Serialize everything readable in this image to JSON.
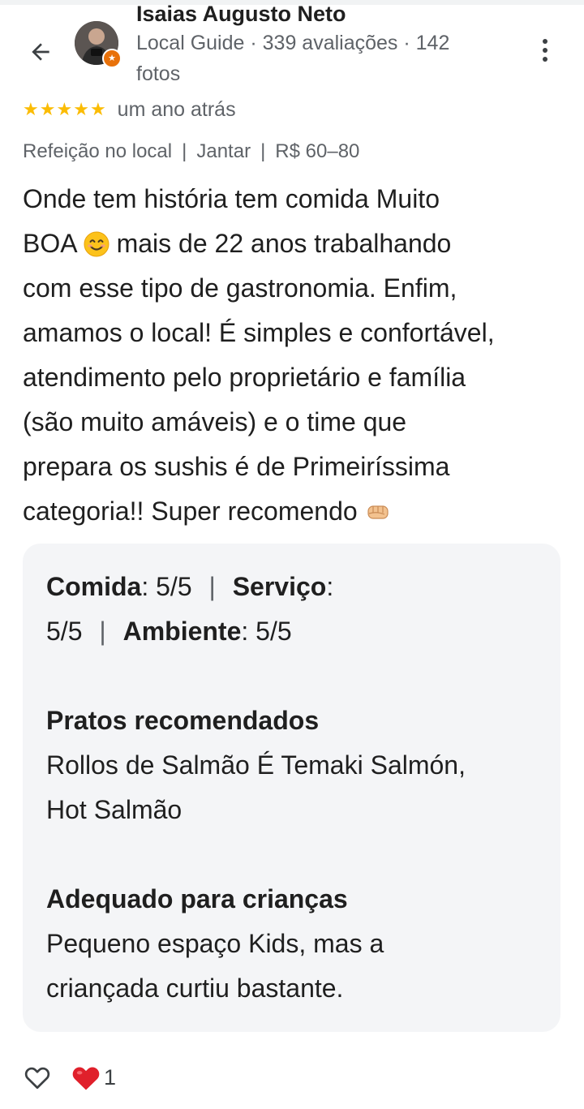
{
  "reviewer": {
    "name": "Isaias Augusto Neto",
    "meta": "Local Guide · 339 avaliações · 142 fotos"
  },
  "rating": {
    "stars": 5,
    "time": "um ano atrás"
  },
  "tags": {
    "service": "Refeição no local",
    "meal": "Jantar",
    "price": "R$ 60–80"
  },
  "review": {
    "line1": "Onde tem história tem comida Muito",
    "line2a": "BOA",
    "line2b": "mais de 22 anos trabalhando",
    "line3": "com esse tipo de gastronomia. Enfim,",
    "line4": "amamos o local! É simples e confortável,",
    "line5": "atendimento pelo proprietário e família",
    "line6": "(são muito amáveis) e o time que",
    "line7": "prepara os sushis é de Primeiríssima",
    "line8": "categoria!! Super recomendo"
  },
  "details": {
    "food_label": "Comida",
    "food_value": ": 5/5",
    "service_label": "Serviço",
    "service_value": "5/5",
    "ambience_label": "Ambiente",
    "ambience_value": ": 5/5",
    "dishes_heading": "Pratos recomendados",
    "dishes_line1": "Rollos de Salmão É Temaki Salmón,",
    "dishes_line2": "Hot Salmão",
    "kids_heading": "Adequado para crianças",
    "kids_line1": "Pequeno espaço Kids, mas a",
    "kids_line2": "criançada curtiu bastante."
  },
  "actions": {
    "reaction_count": "1"
  },
  "icons": [
    "back-arrow-icon",
    "more-vert-icon",
    "star-icon",
    "smiling-face-emoji",
    "fist-emoji",
    "heart-outline-icon",
    "red-heart-icon"
  ],
  "colors": {
    "star": "#fbbc04",
    "badge": "#e8710a",
    "heart": "#e0202b",
    "box": "#f4f5f7"
  }
}
